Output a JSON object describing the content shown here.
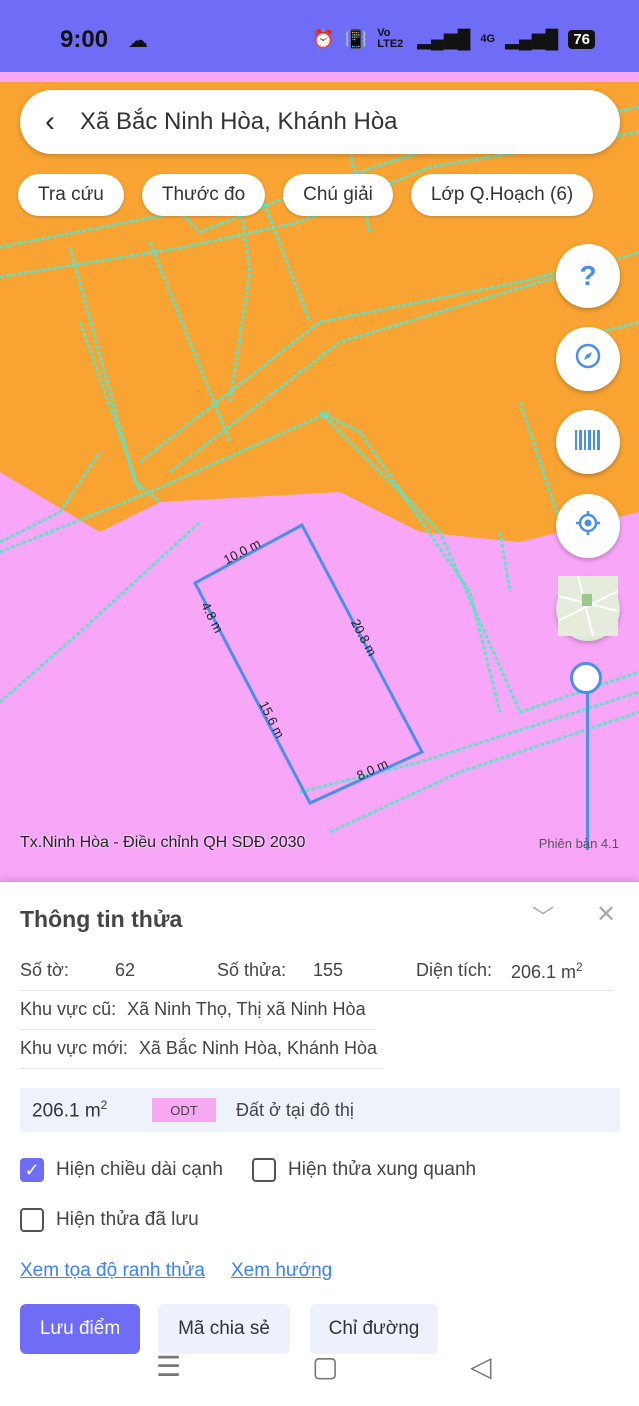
{
  "status": {
    "time": "9:00",
    "battery": "76",
    "network": "4G",
    "volte": "Vo LTE2"
  },
  "search": {
    "title": "Xã Bắc Ninh Hòa, Khánh Hòa"
  },
  "chips": [
    "Tra cứu",
    "Thước đo",
    "Chú giải",
    "Lớp Q.Hoạch (6)"
  ],
  "map": {
    "fab_help": "?",
    "caption": "Tx.Ninh Hòa - Điều chỉnh QH SDĐ 2030",
    "version": "Phiên bản 4.1",
    "edges": {
      "top": "10.0 m",
      "left": "4.8 m",
      "right": "20.8 m",
      "left_lower": "15.6 m",
      "bottom": "8.0 m"
    },
    "colors": {
      "orange": "#f9a432",
      "pink": "#f8a6f8",
      "lines": "#5fe3c4",
      "parcel": "#4a8fe8"
    },
    "slider_level": 1.0
  },
  "panel": {
    "title": "Thông tin thửa",
    "so_to_label": "Số tờ:",
    "so_to": "62",
    "so_thua_label": "Số thửa:",
    "so_thua": "155",
    "dien_tich_label": "Diện tích:",
    "dien_tich": "206.1 m",
    "kv_cu_label": "Khu vực cũ:",
    "kv_cu": "Xã Ninh Thọ, Thị xã Ninh Hòa",
    "kv_moi_label": "Khu vực mới:",
    "kv_moi": "Xã Bắc Ninh Hòa, Khánh Hòa",
    "land_area": "206.1 m",
    "land_code": "ODT",
    "land_type": "Đất ở tại đô thị",
    "sup": "2",
    "cb1": "Hiện chiều dài cạnh",
    "cb1_checked": true,
    "cb2": "Hiện thửa xung quanh",
    "cb2_checked": false,
    "cb3": "Hiện thửa đã lưu",
    "cb3_checked": false,
    "link1": "Xem tọa độ ranh thửa",
    "link2": "Xem hướng",
    "btn1": "Lưu điểm",
    "btn2": "Mã chia sẻ",
    "btn3": "Chỉ đường"
  }
}
